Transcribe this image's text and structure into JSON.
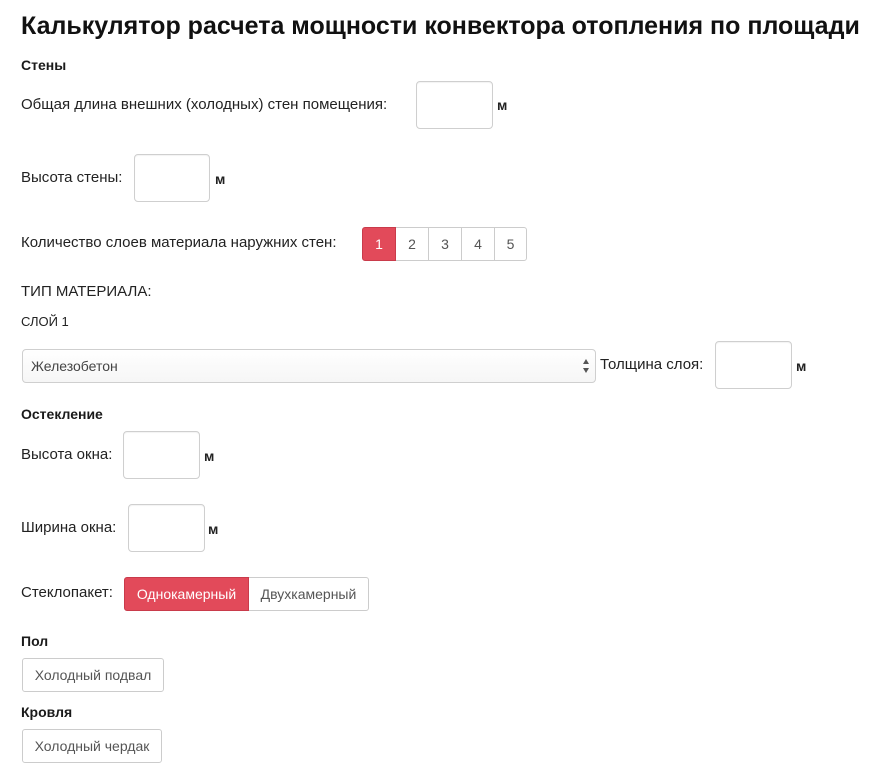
{
  "page_title": "Калькулятор расчета мощности конвектора отопления по площади",
  "accent_color": "#e24a5a",
  "walls": {
    "section_title": "Стены",
    "length_label": "Общая длина внешних (холодных) стен помещения:",
    "length_value": "",
    "length_unit": "м",
    "height_label": "Высота стены:",
    "height_value": "",
    "height_unit": "м",
    "layers_label": "Количество слоев материала наружних стен:",
    "layers_options": [
      "1",
      "2",
      "3",
      "4",
      "5"
    ],
    "layers_selected": "1",
    "material_type_label": "ТИП МАТЕРИАЛА:",
    "layer_label": "СЛОЙ 1",
    "material_selected": "Железобетон",
    "thickness_label": "Толщина слоя:",
    "thickness_value": "",
    "thickness_unit": "м"
  },
  "glazing": {
    "section_title": "Остекление",
    "window_height_label": "Высота окна:",
    "window_height_value": "",
    "window_height_unit": "м",
    "window_width_label": "Ширина окна:",
    "window_width_value": "",
    "window_width_unit": "м",
    "glass_unit_label": "Стеклопакет:",
    "glass_unit_options": [
      "Однокамерный",
      "Двухкамерный"
    ],
    "glass_unit_selected": "Однокамерный"
  },
  "floor": {
    "section_title": "Пол",
    "option_label": "Холодный подвал"
  },
  "roof": {
    "section_title": "Кровля",
    "option_label": "Холодный чердак"
  }
}
